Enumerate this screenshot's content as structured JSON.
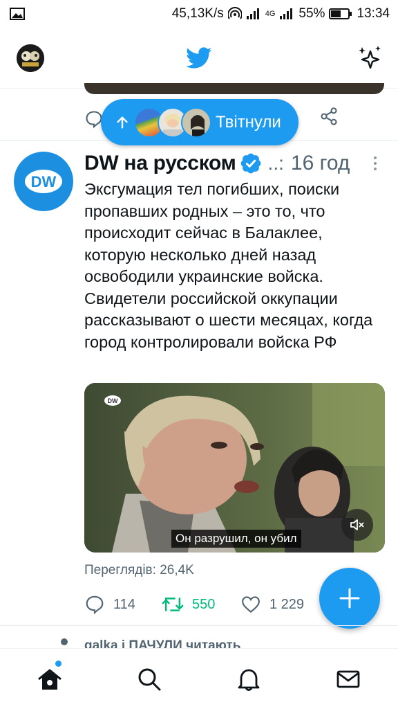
{
  "status_bar": {
    "speed": "45,13K/s",
    "network": "4G",
    "battery": "55%",
    "time": "13:34"
  },
  "pill": {
    "label": "Твітнули"
  },
  "tweet": {
    "author": "DW на русском",
    "handle": "..:",
    "time": "16 год",
    "text": "Эксгумация тел погибших, поиски пропавших родных – это то, что происходит сейчас в Балаклее, которую несколько дней назад освободили украинские войска. Свидетели российской оккупации рассказывают о шести месяцах, когда город контролировали войска РФ",
    "media_subtitle": "Он разрушил, он убил",
    "views": "Переглядів: 26,4K",
    "replies": "114",
    "retweets": "550",
    "likes": "1 229"
  },
  "next_tweet": {
    "social_context": "galka і ПАЧУЛИ читають"
  },
  "colors": {
    "accent": "#1d9bf0",
    "retweet_green": "#00ba7c",
    "secondary_text": "#536471"
  }
}
